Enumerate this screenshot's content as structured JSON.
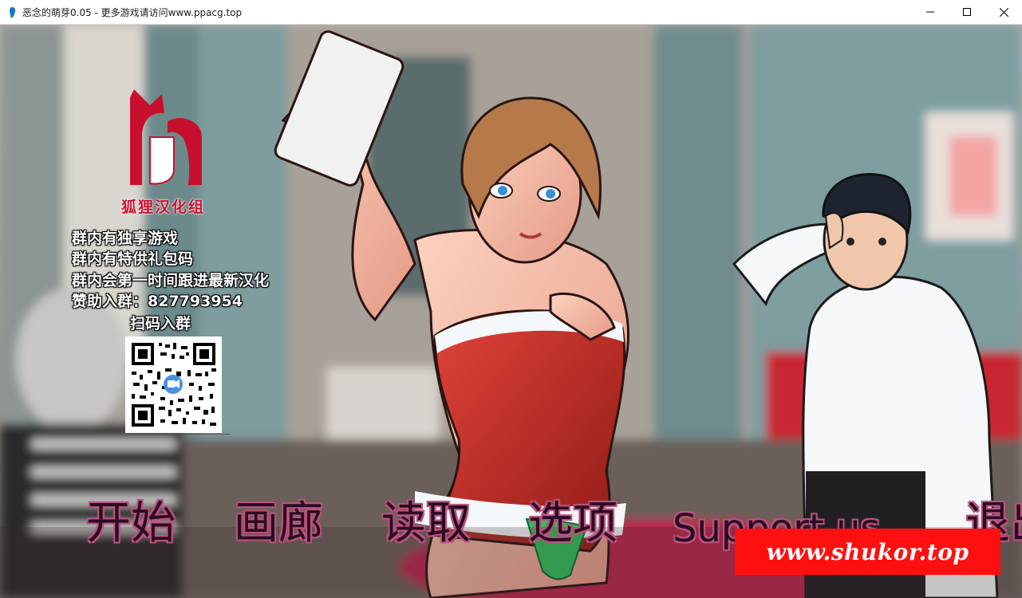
{
  "window": {
    "title": "恶念的萌芽0.05 - 更多游戏请访问www.ppacg.top"
  },
  "sponsor": {
    "logo_text": "狐狸汉化组",
    "lines": [
      "群内有独享游戏",
      "群内有特供礼包码",
      "群内会第一时间跟进最新汉化",
      "赞助入群：827793954"
    ],
    "scan_label": "扫码入群"
  },
  "menu": {
    "start": "开始",
    "gallery": "画廊",
    "load": "读取",
    "options": "选项",
    "support": "Support us",
    "quit": "退出"
  },
  "watermark": {
    "text": "www.shukor.top"
  },
  "colors": {
    "menu_text": "#2a0a26",
    "menu_outline": "#b85478",
    "watermark_bg": "#ff1010",
    "logo_red": "#c8102e"
  }
}
